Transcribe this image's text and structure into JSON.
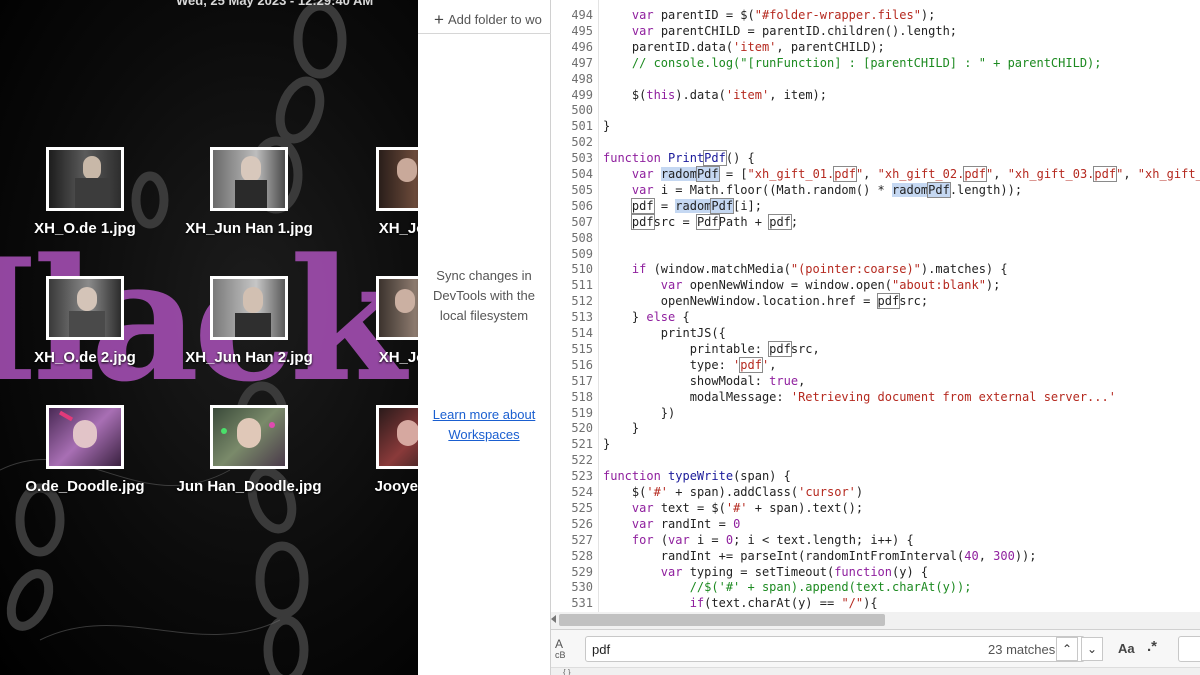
{
  "desktop": {
    "clock": "Wed, 25 May 2023 - 12:29:40 AM",
    "background_word": "Ilack",
    "files": [
      {
        "name": "XH_O.de 1.jpg"
      },
      {
        "name": "XH_Jun Han 1.jpg"
      },
      {
        "name": "XH_Jooye"
      },
      {
        "name": "XH_O.de 2.jpg"
      },
      {
        "name": "XH_Jun Han 2.jpg"
      },
      {
        "name": "XH_Jooye"
      },
      {
        "name": "O.de_Doodle.jpg"
      },
      {
        "name": "Jun Han_Doodle.jpg"
      },
      {
        "name": "Jooyeon_D"
      }
    ]
  },
  "workspace": {
    "add_folder": "Add folder to wo",
    "sync_text": "Sync changes in DevTools with the local filesystem",
    "learn_more": "Learn more about Workspaces"
  },
  "editor": {
    "find": {
      "query": "pdf",
      "matches": "23 matches",
      "case_label": "Aa",
      "regex_label": ".*",
      "prev_icon": "chevron-up-icon",
      "next_icon": "chevron-down-icon"
    },
    "lines": [
      {
        "n": "494",
        "html": "    <span class=\"kw\">var</span> parentID = $(<span class=\"str\">\"#folder-wrapper.files\"</span>);"
      },
      {
        "n": "495",
        "html": "    <span class=\"kw\">var</span> parentCHILD = parentID.children().length;"
      },
      {
        "n": "496",
        "html": "    parentID.data(<span class=\"str\">'item'</span>, parentCHILD);"
      },
      {
        "n": "497",
        "html": "    <span class=\"cm\">// console.log(\"[runFunction] : [parentCHILD] : \" + parentCHILD);</span>"
      },
      {
        "n": "498",
        "html": ""
      },
      {
        "n": "499",
        "html": "    $(<span class=\"kw\">this</span>).data(<span class=\"str\">'item'</span>, item);"
      },
      {
        "n": "500",
        "html": ""
      },
      {
        "n": "501",
        "html": "}"
      },
      {
        "n": "502",
        "html": ""
      },
      {
        "n": "503",
        "html": "<span class=\"kw\">function</span> <span class=\"fn\">Print<span class=\"bx\">Pdf</span></span>() {"
      },
      {
        "n": "504",
        "html": "    <span class=\"kw\">var</span> <span class=\"sel\">radom<span class=\"bx\">Pdf</span></span> = [<span class=\"str\">\"xh_gift_01.<span class=\"bx\">pdf</span>\"</span>, <span class=\"str\">\"xh_gift_02.<span class=\"bx\">pdf</span>\"</span>, <span class=\"str\">\"xh_gift_03.<span class=\"bx\">pdf</span>\"</span>, <span class=\"str\">\"xh_gift_</span>"
      },
      {
        "n": "505",
        "html": "    <span class=\"kw\">var</span> i = Math.floor((Math.random() * <span class=\"sel\">radom<span class=\"bx\">Pdf</span></span>.length));"
      },
      {
        "n": "506",
        "html": "    <span class=\"bx\">pdf</span> = <span class=\"sel\">radom<span class=\"bx\">Pdf</span></span>[i];"
      },
      {
        "n": "507",
        "html": "    <span class=\"bx\">pdf</span>src = <span class=\"bx\">Pdf</span>Path + <span class=\"bx\">pdf</span>;"
      },
      {
        "n": "508",
        "html": ""
      },
      {
        "n": "509",
        "html": ""
      },
      {
        "n": "510",
        "html": "    <span class=\"kw\">if</span> (window.matchMedia(<span class=\"str\">\"(pointer:coarse)\"</span>).matches) {"
      },
      {
        "n": "511",
        "html": "        <span class=\"kw\">var</span> openNewWindow = window.open(<span class=\"str\">\"about:blank\"</span>);"
      },
      {
        "n": "512",
        "html": "        openNewWindow.location.href = <span class=\"bx\">pdf</span>src;"
      },
      {
        "n": "513",
        "html": "    } <span class=\"kw\">else</span> {"
      },
      {
        "n": "514",
        "html": "        printJS({"
      },
      {
        "n": "515",
        "html": "            printable: <span class=\"bx\">pdf</span>src,"
      },
      {
        "n": "516",
        "html": "            type: <span class=\"str\">'<span class=\"bx\">pdf</span>'</span>,"
      },
      {
        "n": "517",
        "html": "            showModal: <span class=\"kw\">true</span>,"
      },
      {
        "n": "518",
        "html": "            modalMessage: <span class=\"str\">'Retrieving document from external server...'</span>"
      },
      {
        "n": "519",
        "html": "        })"
      },
      {
        "n": "520",
        "html": "    }"
      },
      {
        "n": "521",
        "html": "}"
      },
      {
        "n": "522",
        "html": ""
      },
      {
        "n": "523",
        "html": "<span class=\"kw\">function</span> <span class=\"fn\">typeWrite</span>(span) {"
      },
      {
        "n": "524",
        "html": "    $(<span class=\"str\">'#'</span> + span).addClass(<span class=\"str\">'cursor'</span>)"
      },
      {
        "n": "525",
        "html": "    <span class=\"kw\">var</span> text = $(<span class=\"str\">'#'</span> + span).text();"
      },
      {
        "n": "526",
        "html": "    <span class=\"kw\">var</span> randInt = <span class=\"kw\">0</span>"
      },
      {
        "n": "527",
        "html": "    <span class=\"kw\">for</span> (<span class=\"kw\">var</span> i = <span class=\"kw\">0</span>; i &lt; text.length; i++) {"
      },
      {
        "n": "528",
        "html": "        randInt += parseInt(randomIntFromInterval(<span class=\"kw\">40</span>, <span class=\"kw\">300</span>));"
      },
      {
        "n": "529",
        "html": "        <span class=\"kw\">var</span> typing = setTimeout(<span class=\"kw\">function</span>(y) {"
      },
      {
        "n": "530",
        "html": "            <span class=\"cm\">//$('#' + span).append(text.charAt(y));</span>"
      },
      {
        "n": "531",
        "html": "            <span class=\"kw\">if</span>(text.charAt(y) == <span class=\"str\">\"/\"</span>){"
      }
    ]
  }
}
